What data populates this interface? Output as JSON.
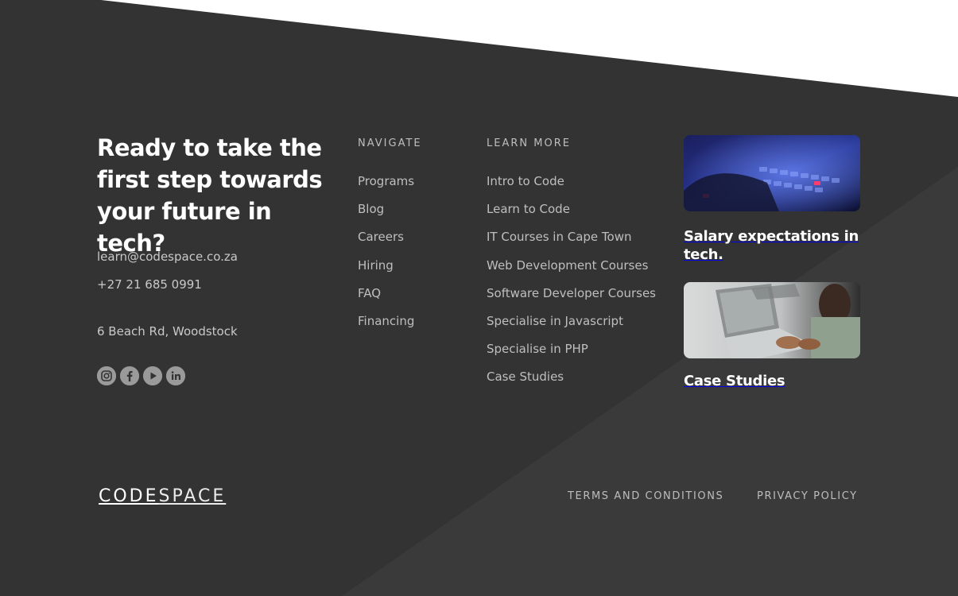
{
  "cta": {
    "headline": "Ready to take the first step towards your future in tech?",
    "email": "learn@codespace.co.za",
    "phone": "+27 21 685 0991",
    "address": "6 Beach Rd, Woodstock"
  },
  "social": [
    {
      "icon": "instagram-icon"
    },
    {
      "icon": "facebook-icon"
    },
    {
      "icon": "youtube-icon"
    },
    {
      "icon": "linkedin-icon"
    }
  ],
  "navigate": {
    "heading": "NAVIGATE",
    "links": [
      "Programs",
      "Blog",
      "Careers",
      "Hiring",
      "FAQ",
      "Financing"
    ]
  },
  "learn_more": {
    "heading": "LEARN MORE",
    "links": [
      "Intro to Code",
      "Learn to Code",
      "IT Courses in Cape Town",
      "Web Development Courses",
      "Software Developer Courses",
      "Specialise in Javascript",
      "Specialise in PHP",
      "Case Studies"
    ]
  },
  "cards": [
    {
      "title": "Salary expectations in tech."
    },
    {
      "title": "Case Studies"
    }
  ],
  "logo": {
    "bold_part": "CODE",
    "light_part": "SPACE"
  },
  "legal": {
    "terms": "TERMS AND CONDITIONS",
    "privacy": "PRIVACY POLICY"
  },
  "colors": {
    "background": "#ffffff",
    "footer": "#333333",
    "footer_accent": "#3a3a3a",
    "text_muted": "#bfbfbf",
    "text_light": "#ffffff"
  }
}
